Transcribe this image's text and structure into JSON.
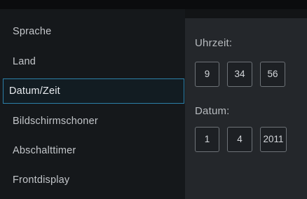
{
  "menu": {
    "items": [
      {
        "label": "Sprache"
      },
      {
        "label": "Land"
      },
      {
        "label": "Datum/Zeit"
      },
      {
        "label": "Bildschirmschoner"
      },
      {
        "label": "Abschalttimer"
      },
      {
        "label": "Frontdisplay"
      }
    ],
    "selected": "Datum/Zeit"
  },
  "time": {
    "label": "Uhrzeit:",
    "hour": "9",
    "minute": "34",
    "second": "56"
  },
  "date": {
    "label": "Datum:",
    "day": "1",
    "month": "4",
    "year": "2011"
  },
  "colors": {
    "selection_border": "#2c7fa8",
    "panel_background": "#24272b",
    "menu_background": "#15181b"
  }
}
